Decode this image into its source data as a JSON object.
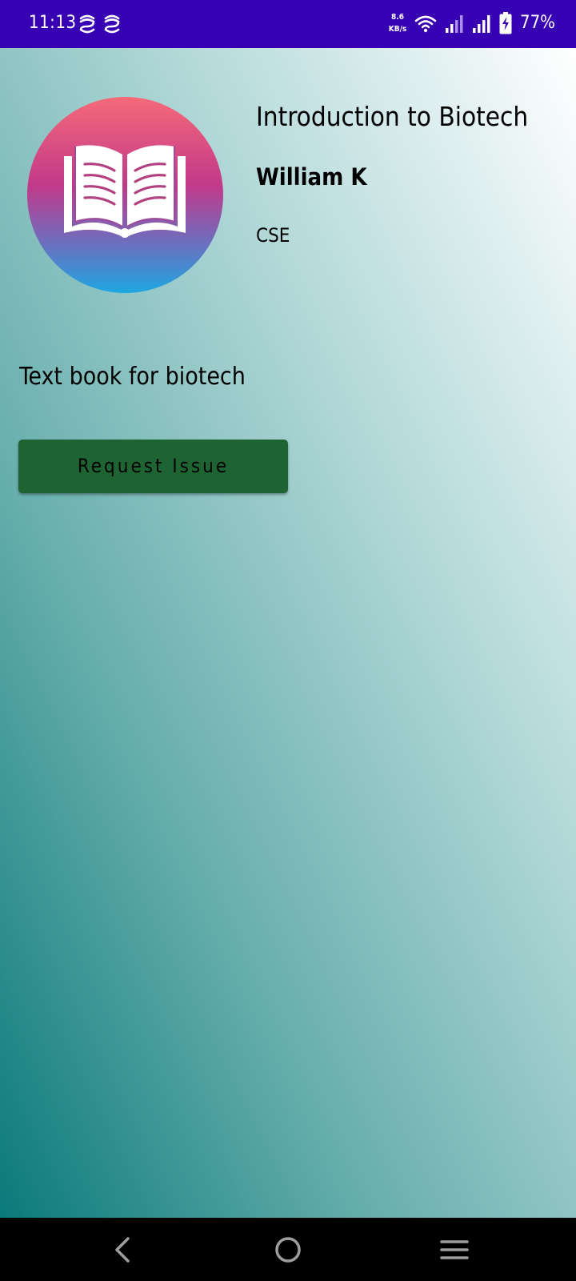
{
  "status_bar": {
    "time": "11:13",
    "net_speed_value": "8.6",
    "net_speed_unit": "KB/s",
    "battery": "77%",
    "notification_icons": [
      "s-circle-app-icon",
      "s-circle-app-icon"
    ],
    "icons": [
      "wifi-icon",
      "signal-icon",
      "signal-icon",
      "battery-charging-icon"
    ]
  },
  "book": {
    "cover_icon": "open-book-icon",
    "title": "Introduction to Biotech",
    "author": "William K",
    "department": "CSE",
    "description": "Text book for biotech"
  },
  "actions": {
    "request_label": "Request Issue"
  },
  "nav_bar": {
    "icons": [
      "back-icon",
      "home-icon",
      "menu-icon"
    ]
  },
  "colors": {
    "status_bar": "#3700B3",
    "button": "#1e6432",
    "nav_bar": "#000000"
  }
}
